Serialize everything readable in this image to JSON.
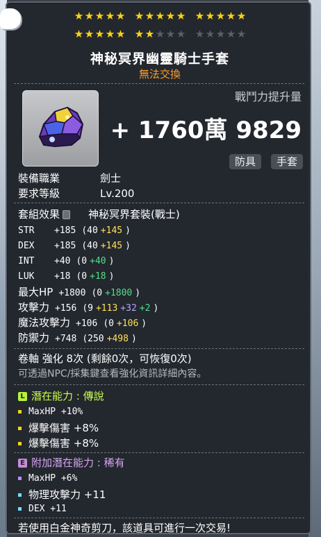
{
  "stars": {
    "row1": [
      5,
      5,
      5
    ],
    "row2": [
      5,
      2,
      0
    ],
    "max_per_group": 5
  },
  "item": {
    "name": "神秘冥界幽靈騎士手套",
    "trade": "無法交換",
    "power_label": "戰鬥力提升量",
    "power_value": "+ 1760萬 9829",
    "tags": [
      "防具",
      "手套"
    ]
  },
  "req": {
    "job_label": "裝備職業",
    "job_value": "劍士",
    "level_label": "要求等級",
    "level_value": "Lv.200"
  },
  "set": {
    "label": "套組效果",
    "value": "神秘冥界套裝(戰士)"
  },
  "stats": [
    {
      "name": "STR",
      "total": "+185",
      "base": "(40",
      "bonus": [
        {
          "v": "+145",
          "c": "yellow"
        }
      ],
      "close": ")"
    },
    {
      "name": "DEX",
      "total": "+185",
      "base": "(40",
      "bonus": [
        {
          "v": "+145",
          "c": "yellow"
        }
      ],
      "close": ")"
    },
    {
      "name": "INT",
      "total": "+40",
      "base": "(0",
      "bonus": [
        {
          "v": "+40",
          "c": "green"
        }
      ],
      "close": ")"
    },
    {
      "name": "LUK",
      "total": "+18",
      "base": "(0",
      "bonus": [
        {
          "v": "+18",
          "c": "green"
        }
      ],
      "close": ")"
    },
    {
      "name": "最大HP",
      "total": "+1800",
      "base": "(0",
      "bonus": [
        {
          "v": "+1800",
          "c": "green"
        }
      ],
      "close": ")"
    },
    {
      "name": "攻擊力",
      "total": "+156",
      "base": "(9",
      "bonus": [
        {
          "v": "+113",
          "c": "yellow"
        },
        {
          "v": "+32",
          "c": "purple"
        },
        {
          "v": "+2",
          "c": "green"
        }
      ],
      "close": ")"
    },
    {
      "name": "魔法攻擊力",
      "total": "+106",
      "base": "(0",
      "bonus": [
        {
          "v": "+106",
          "c": "yellow"
        }
      ],
      "close": ")"
    },
    {
      "name": "防禦力",
      "total": "+748",
      "base": "(250",
      "bonus": [
        {
          "v": "+498",
          "c": "yellow"
        }
      ],
      "close": ")"
    }
  ],
  "scroll": {
    "line": "卷軸 強化 8次 (剩餘0次，可恢復0次)",
    "hint": "可透過NPC/採集鍵查看強化資訊詳細內容。"
  },
  "potential": {
    "title": "潛在能力 : 傳說",
    "lines": [
      "MaxHP +10%",
      "爆擊傷害 +8%",
      "爆擊傷害 +8%"
    ]
  },
  "bonus_potential": {
    "title": "附加潛在能力 : 稀有",
    "lines": [
      "MaxHP +6%",
      "物理攻擊力 +11",
      "DEX +11"
    ]
  },
  "footer": "若使用白金神奇剪刀，該道具可進行一次交易!",
  "colors": {
    "star_on": "#f7d21b",
    "star_off": "#5b5f66",
    "trade": "#ff9d2a",
    "bonus_yellow": "#ffe05a",
    "bonus_green": "#52e08a",
    "bonus_purple": "#b6a4ff",
    "legendary": "#c8ff4a",
    "rare": "#d7a6f2"
  },
  "icons": {
    "item": "purple-gauntlet-icon",
    "set_lock": "lock-icon",
    "legendary_badge": "L",
    "rare_badge": "E",
    "corner": "cursor-hand-icon"
  }
}
